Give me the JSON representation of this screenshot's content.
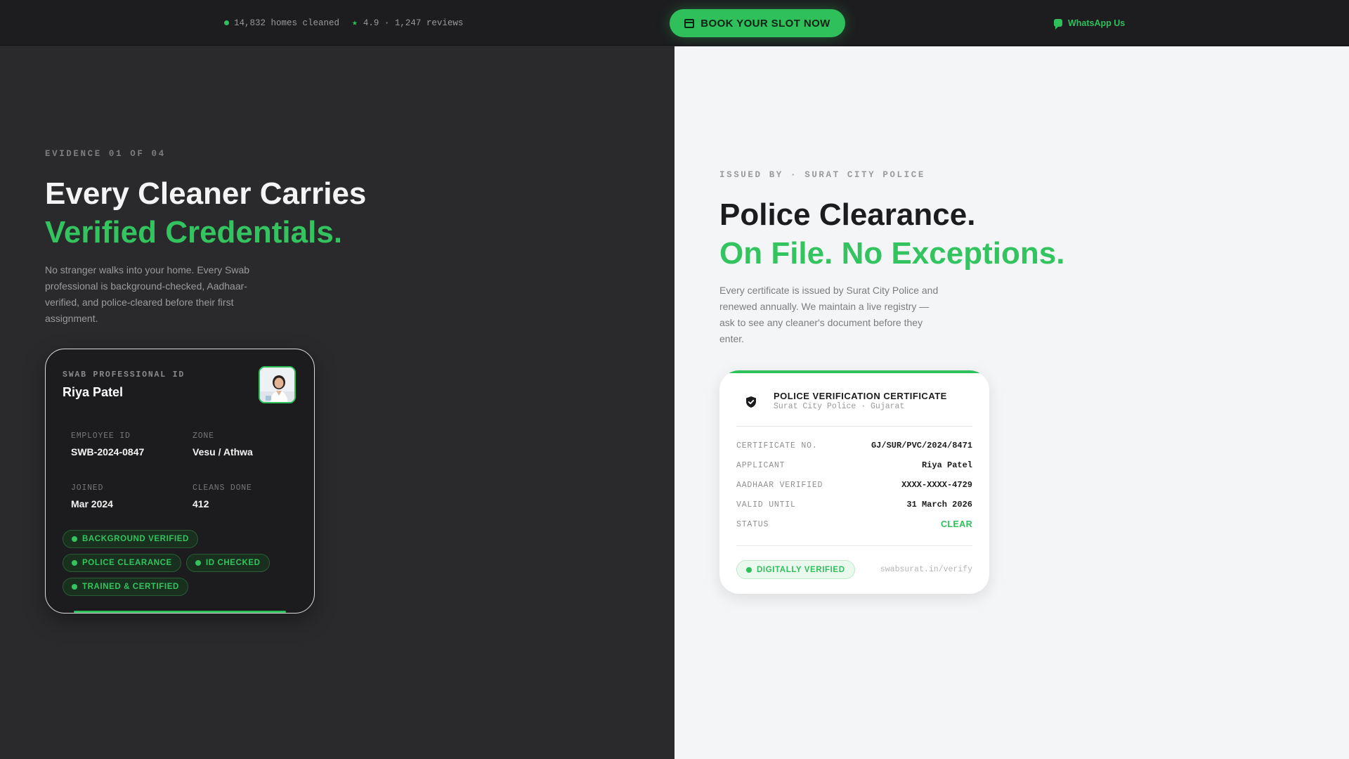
{
  "topbar": {
    "homes_cleaned": "14,832 homes cleaned",
    "rating": "4.9 · 1,247 reviews",
    "book_label": "BOOK YOUR SLOT NOW",
    "whatsapp_label": "WhatsApp Us"
  },
  "left": {
    "eyebrow": "EVIDENCE 01 OF 04",
    "heading_white": "Every Cleaner Carries",
    "heading_green": "Verified Credentials.",
    "paragraph": "No stranger walks into your home. Every Swab professional is background-checked, Aadhaar-verified, and police-cleared before their first assignment.",
    "id_card": {
      "label": "SWAB PROFESSIONAL ID",
      "name": "Riya Patel",
      "fields": [
        {
          "key": "EMPLOYEE ID",
          "value": "SWB-2024-0847"
        },
        {
          "key": "ZONE",
          "value": "Vesu / Athwa"
        },
        {
          "key": "JOINED",
          "value": "Mar 2024"
        },
        {
          "key": "CLEANS DONE",
          "value": "412"
        }
      ],
      "badges": [
        "BACKGROUND VERIFIED",
        "POLICE CLEARANCE",
        "ID CHECKED",
        "TRAINED & CERTIFIED"
      ]
    }
  },
  "right": {
    "eyebrow": "ISSUED BY · SURAT CITY POLICE",
    "heading_dark": "Police Clearance.",
    "heading_green": "On File. No Exceptions.",
    "paragraph": "Every certificate is issued by Surat City Police and renewed annually. We maintain a live registry — ask to see any cleaner's document before they enter.",
    "certificate": {
      "title": "POLICE VERIFICATION CERTIFICATE",
      "subtitle": "Surat City Police · Gujarat",
      "rows": [
        {
          "key": "CERTIFICATE NO.",
          "value": "GJ/SUR/PVC/2024/8471"
        },
        {
          "key": "APPLICANT",
          "value": "Riya Patel"
        },
        {
          "key": "AADHAAR VERIFIED",
          "value": "XXXX-XXXX-4729"
        },
        {
          "key": "VALID UNTIL",
          "value": "31 March 2026"
        },
        {
          "key": "STATUS",
          "value": "CLEAR"
        }
      ],
      "badge": "DIGITALLY VERIFIED",
      "verify_url": "swabsurat.in/verify"
    }
  },
  "colors": {
    "accent": "#2fbf5b",
    "dark_bg": "#2a2a2d",
    "light_bg": "#f4f5f7",
    "topbar_bg": "#1d1d1f"
  },
  "icons": [
    "status-dot-icon",
    "star-icon",
    "calendar-icon",
    "chat-bubble-icon",
    "shield-check-icon",
    "check-dot-icon",
    "avatar-photo"
  ]
}
